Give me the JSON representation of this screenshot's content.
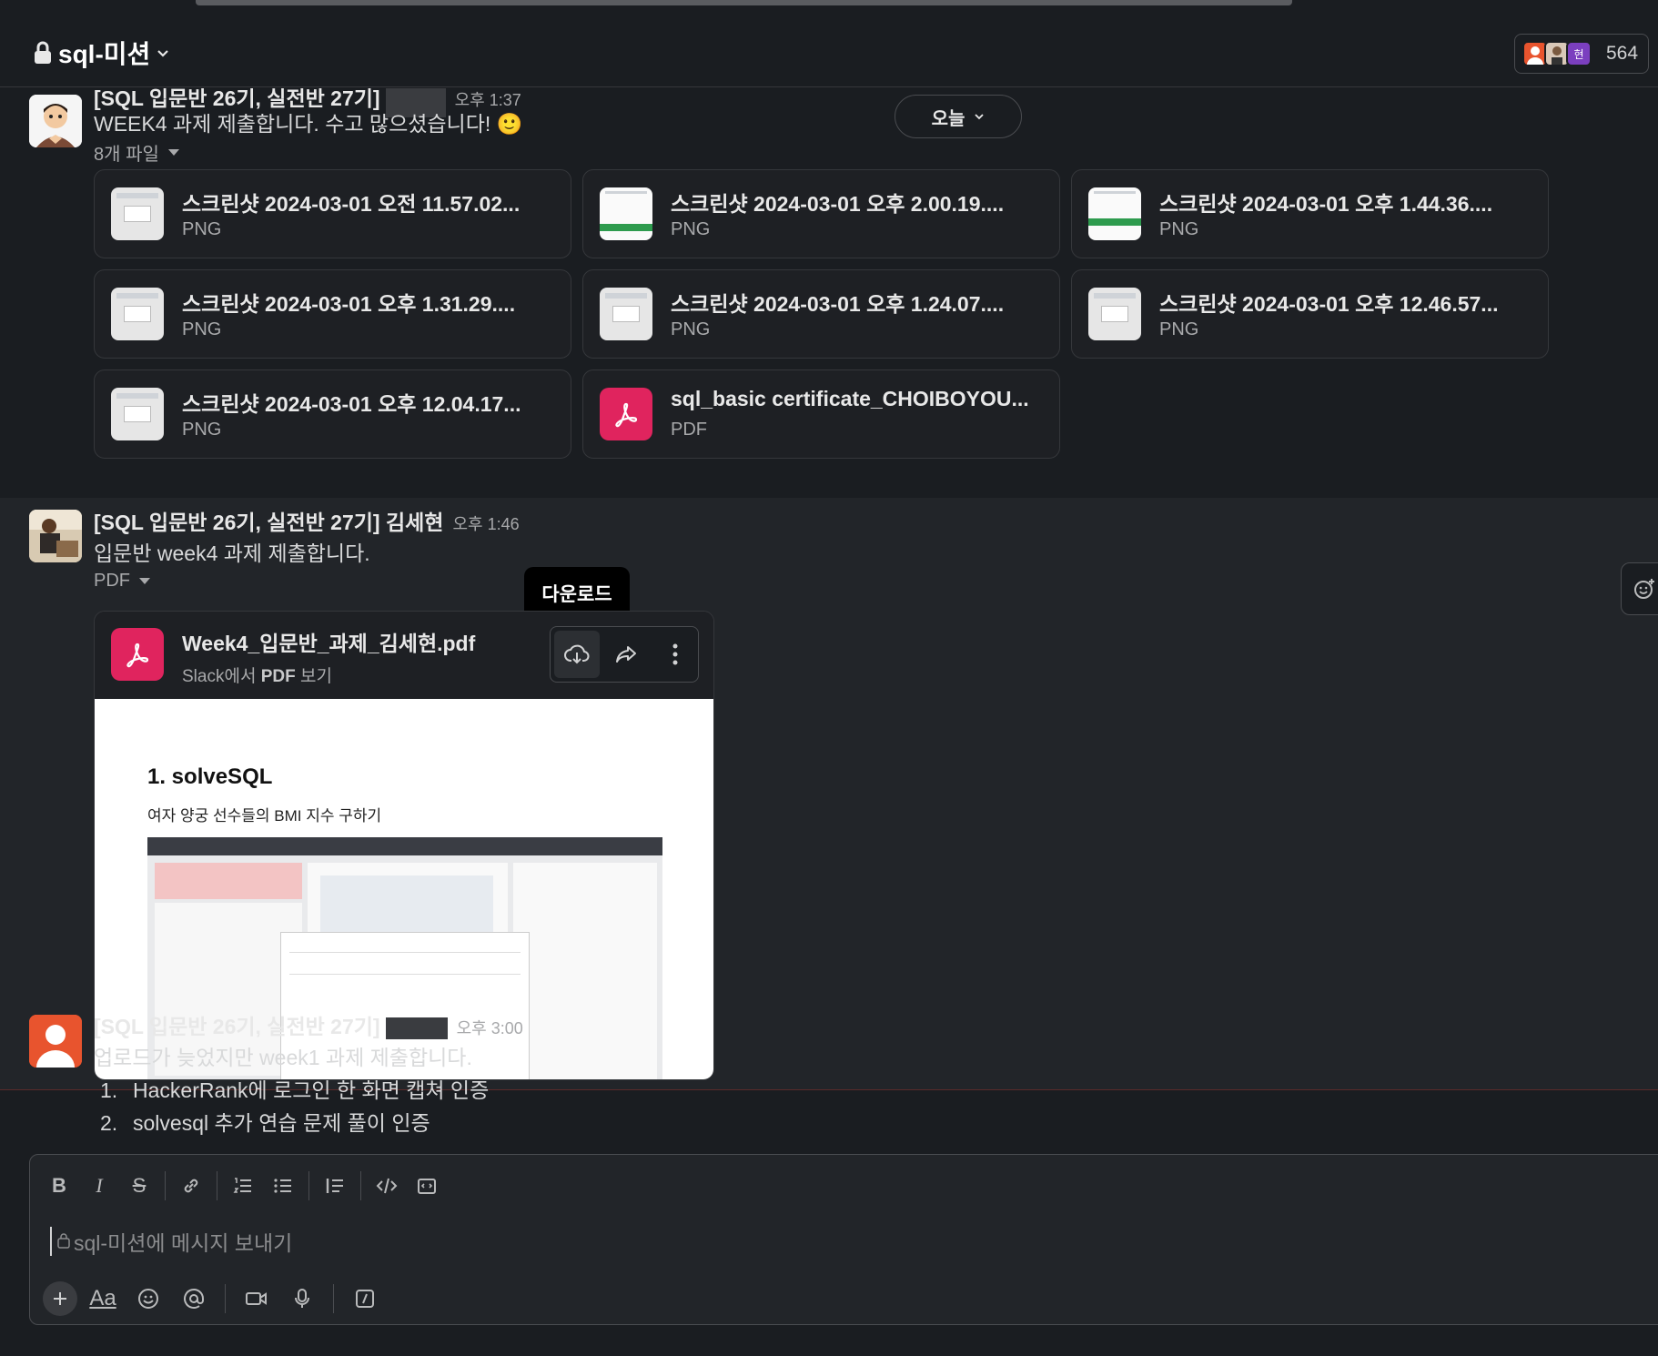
{
  "channel": {
    "name": "sql-미션",
    "member_count": "564",
    "member_avatar_initial": "현"
  },
  "date_pill": {
    "label": "오늘"
  },
  "messages": [
    {
      "sender": "[SQL 입문반 26기, 실전반 27기]",
      "time": "오후 1:37",
      "text": "WEEK4 과제 제출합니다. 수고 많으셨습니다! 🙂",
      "files_label": "8개 파일",
      "files": [
        {
          "name": "스크린샷 2024-03-01 오전 11.57.02...",
          "type": "PNG"
        },
        {
          "name": "스크린샷 2024-03-01 오후 2.00.19....",
          "type": "PNG"
        },
        {
          "name": "스크린샷 2024-03-01 오후 1.44.36....",
          "type": "PNG"
        },
        {
          "name": "스크린샷 2024-03-01 오후 1.31.29....",
          "type": "PNG"
        },
        {
          "name": "스크린샷 2024-03-01 오후 1.24.07....",
          "type": "PNG"
        },
        {
          "name": "스크린샷 2024-03-01 오후 12.46.57...",
          "type": "PNG"
        },
        {
          "name": "스크린샷 2024-03-01 오후 12.04.17...",
          "type": "PNG"
        },
        {
          "name": "sql_basic certificate_CHOIBOYOU...",
          "type": "PDF"
        }
      ]
    },
    {
      "sender": "[SQL 입문반 26기, 실전반 27기] 김세현",
      "time": "오후 1:46",
      "text": "입문반 week4 과제 제출합니다.",
      "files_label": "PDF",
      "pdf": {
        "name": "Week4_입문반_과제_김세현.pdf",
        "sub_prefix": "Slack에서",
        "sub_bold": "PDF",
        "sub_suffix": "보기",
        "preview_title": "1. solveSQL",
        "preview_subtitle": "여자 양궁 선수들의 BMI 지수 구하기"
      },
      "tooltip": "다운로드"
    },
    {
      "sender": "[SQL 입문반 26기, 실전반 27기]",
      "time": "오후 3:00",
      "text": "업로드가 늦었지만 week1 과제 제출합니다.",
      "list": [
        {
          "n": "1.",
          "text": "HackerRank에 로그인 한 화면 캡쳐 인증"
        },
        {
          "n": "2.",
          "text": "solvesql 추가 연습 문제 풀이 인증"
        }
      ]
    }
  ],
  "composer": {
    "placeholder": "sql-미션에 메시지 보내기",
    "format_label": "Aa"
  },
  "colors": {
    "bg": "#1a1d21",
    "highlight": "#222529",
    "pdf_red": "#e0245e",
    "avatar_red": "#e8542e"
  }
}
